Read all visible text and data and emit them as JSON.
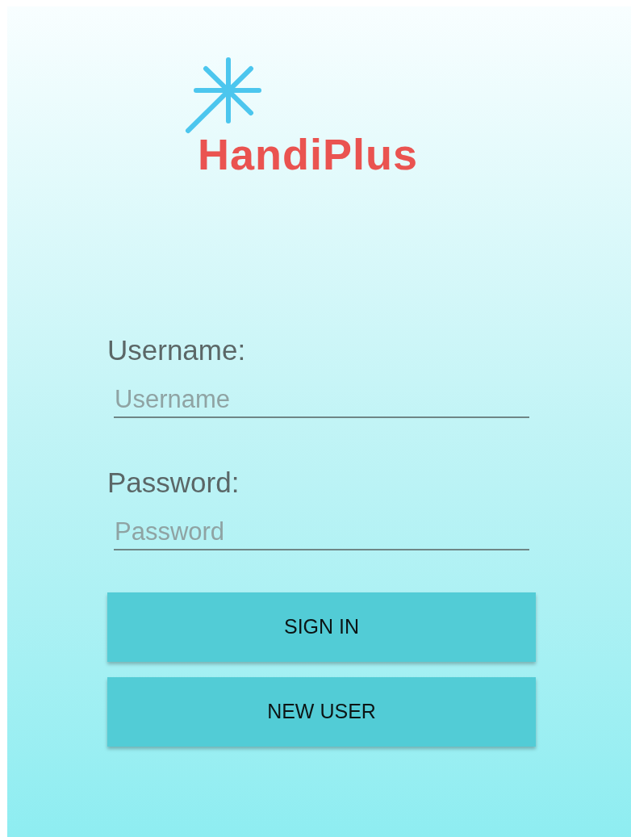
{
  "logo": {
    "text": "HandiPlus"
  },
  "fields": [
    {
      "label": "Username:",
      "placeholder": "Username"
    },
    {
      "label": "Password:",
      "placeholder": "Password"
    }
  ],
  "buttons": [
    "SIGN IN",
    "NEW USER"
  ]
}
